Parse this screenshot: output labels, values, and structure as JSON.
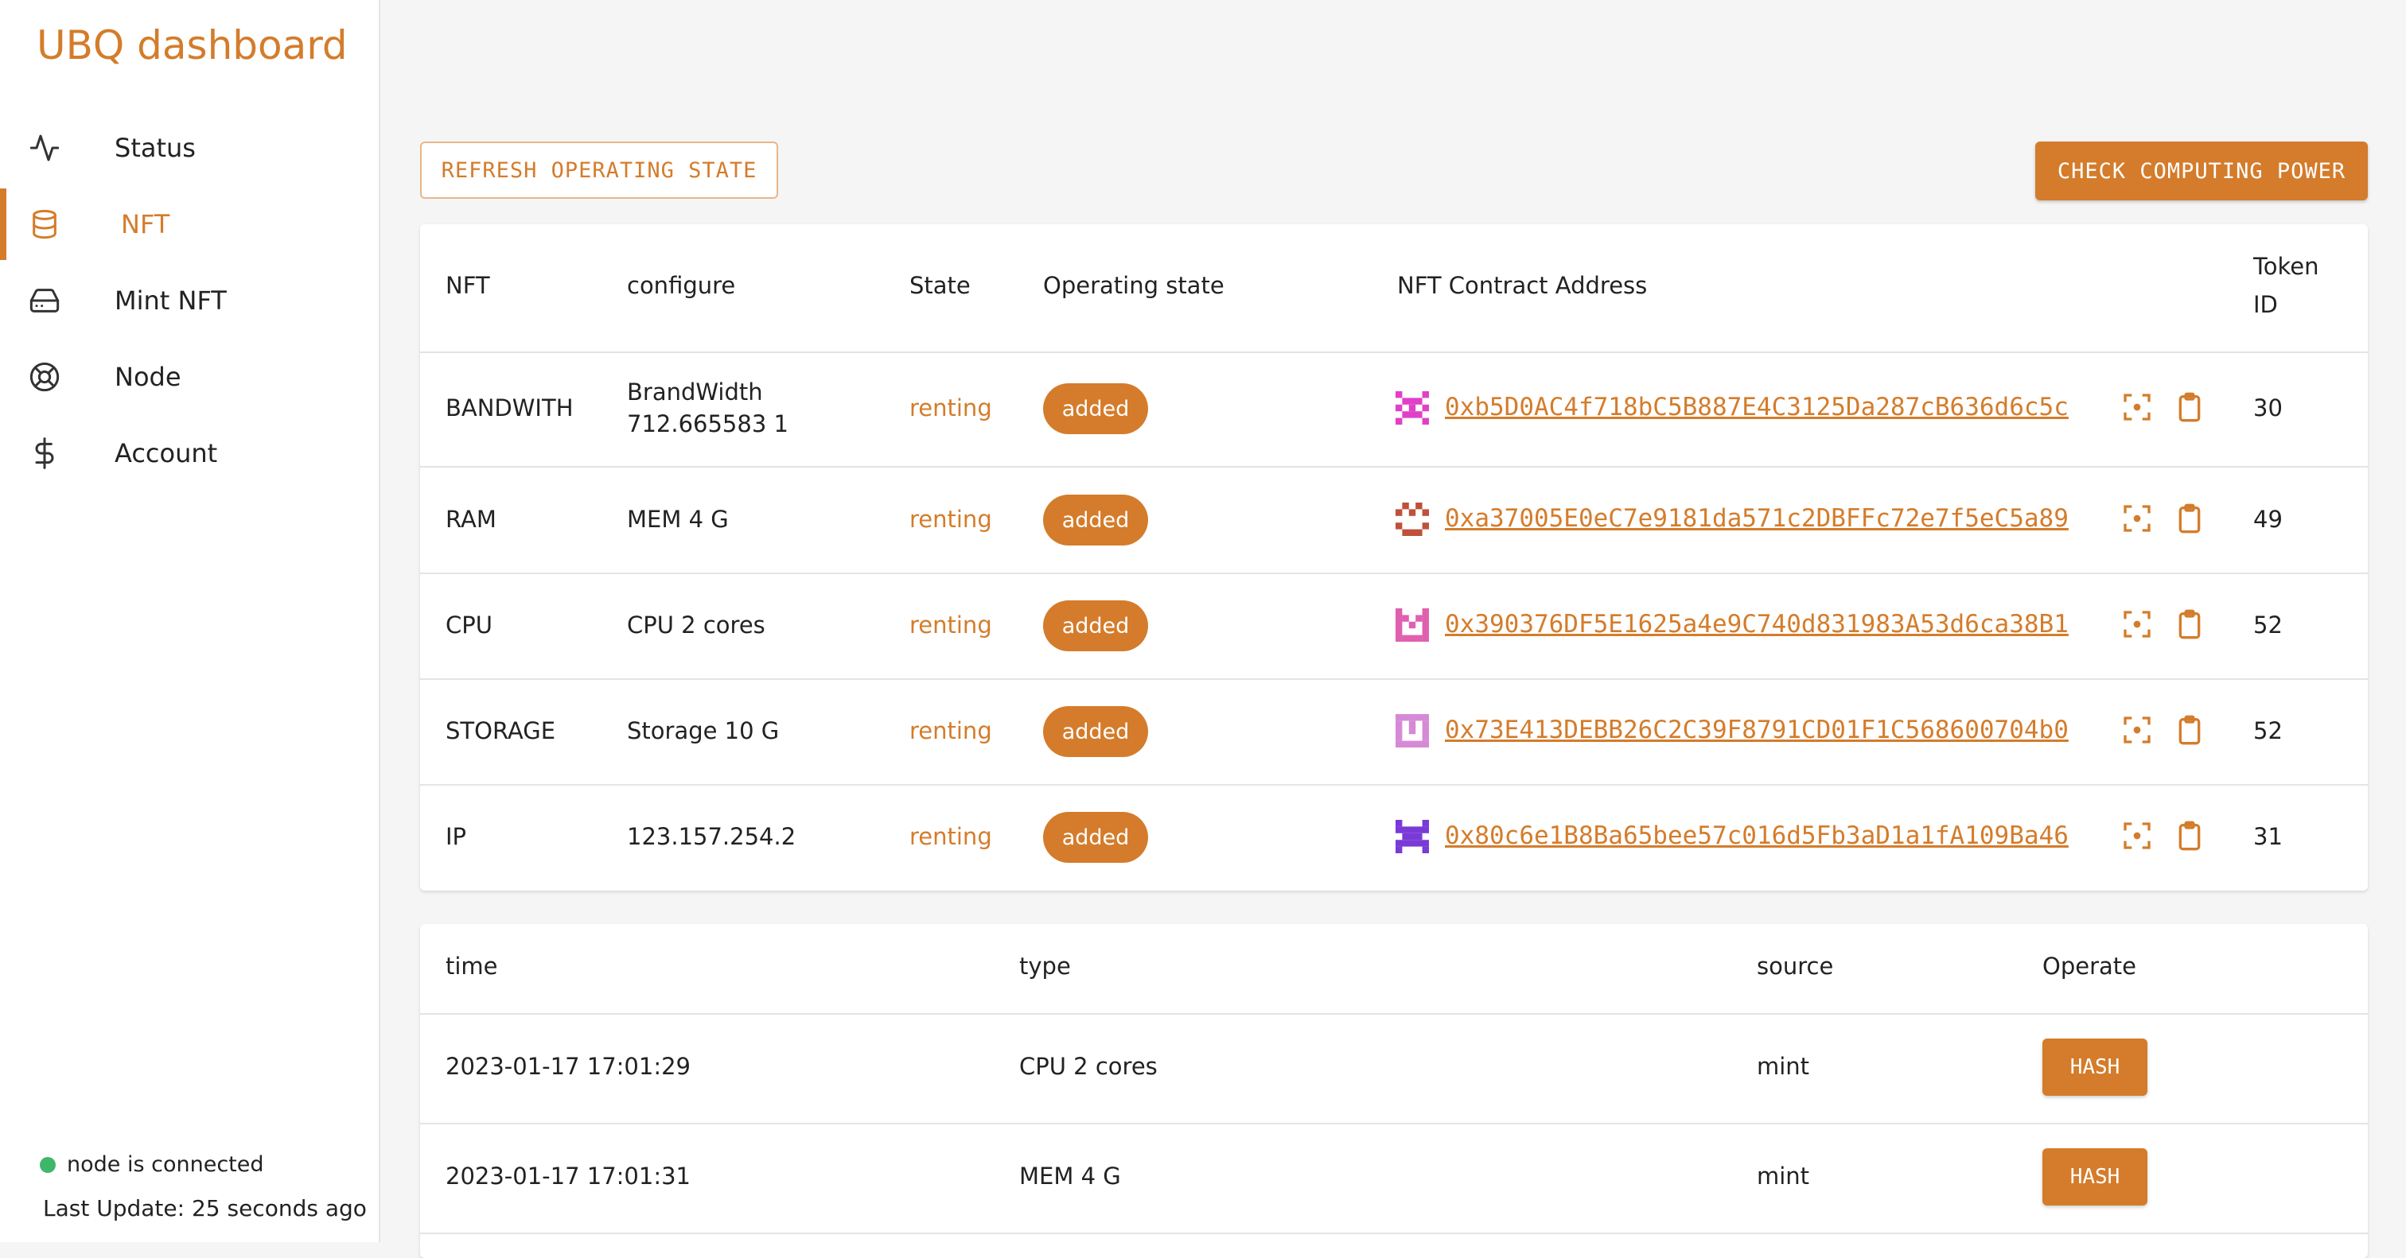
{
  "app": {
    "title": "UBQ dashboard"
  },
  "sidebar": {
    "items": [
      {
        "label": "Status",
        "icon": "activity-icon"
      },
      {
        "label": "NFT",
        "icon": "database-icon",
        "active": true
      },
      {
        "label": "Mint NFT",
        "icon": "hard-drive-icon"
      },
      {
        "label": "Node",
        "icon": "life-buoy-icon"
      },
      {
        "label": "Account",
        "icon": "dollar-icon"
      }
    ],
    "connection_status": "node is connected",
    "last_update": "Last Update: 25 seconds ago"
  },
  "toolbar": {
    "refresh_label": "REFRESH OPERATING STATE",
    "check_label": "CHECK COMPUTING POWER"
  },
  "nft_table": {
    "headers": {
      "nft": "NFT",
      "configure": "configure",
      "state": "State",
      "operating": "Operating state",
      "address": "NFT Contract Address",
      "token_line1": "Token",
      "token_line2": "ID"
    },
    "rows": [
      {
        "nft": "BANDWITH",
        "configure_line1": "BrandWidth",
        "configure_line2": "712.665583 1",
        "state": "renting",
        "operating": "added",
        "address": "0xb5D0AC4f718bC5B887E4C3125Da287cB636d6c5c",
        "token": "30",
        "identicon_color": "#e040c8"
      },
      {
        "nft": "RAM",
        "configure_line1": "MEM 4 G",
        "configure_line2": "",
        "state": "renting",
        "operating": "added",
        "address": "0xa37005E0eC7e9181da571c2DBFFc72e7f5eC5a89",
        "token": "49",
        "identicon_color": "#c0503a"
      },
      {
        "nft": "CPU",
        "configure_line1": "CPU 2 cores",
        "configure_line2": "",
        "state": "renting",
        "operating": "added",
        "address": "0x390376DF5E1625a4e9C740d831983A53d6ca38B1",
        "token": "52",
        "identicon_color": "#e060b0"
      },
      {
        "nft": "STORAGE",
        "configure_line1": "Storage 10 G",
        "configure_line2": "",
        "state": "renting",
        "operating": "added",
        "address": "0x73E413DEBB26C2C39F8791CD01F1C568600704b0",
        "token": "52",
        "identicon_color": "#d68ad6"
      },
      {
        "nft": "IP",
        "configure_line1": "123.157.254.2",
        "configure_line2": "",
        "state": "renting",
        "operating": "added",
        "address": "0x80c6e1B8Ba65bee57c016d5Fb3aD1a1fA109Ba46",
        "token": "31",
        "identicon_color": "#7a3ad8"
      }
    ]
  },
  "history_table": {
    "headers": {
      "time": "time",
      "type": "type",
      "source": "source",
      "operate": "Operate"
    },
    "rows": [
      {
        "time": "2023-01-17 17:01:29",
        "type": "CPU 2 cores",
        "source": "mint",
        "action": "HASH"
      },
      {
        "time": "2023-01-17 17:01:31",
        "type": "MEM 4 G",
        "source": "mint",
        "action": "HASH"
      }
    ]
  },
  "colors": {
    "accent": "#d47c2b",
    "connected": "#3fb76b"
  }
}
